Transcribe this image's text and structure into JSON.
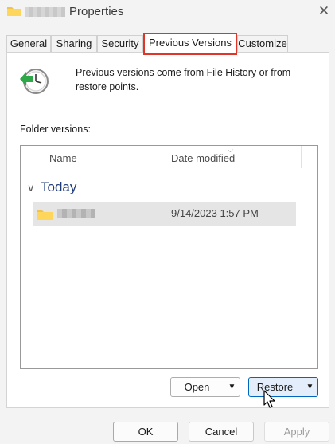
{
  "window": {
    "title": "Properties",
    "close_label": "✕"
  },
  "tabs": [
    {
      "label": "General"
    },
    {
      "label": "Sharing"
    },
    {
      "label": "Security"
    },
    {
      "label": "Previous Versions"
    },
    {
      "label": "Customize"
    }
  ],
  "active_tab": "Previous Versions",
  "intro_text": "Previous versions come from File History or from restore points.",
  "folder_versions_label": "Folder versions:",
  "list": {
    "columns": [
      "Name",
      "Date modified"
    ],
    "groups": [
      {
        "label": "Today",
        "items": [
          {
            "date_modified": "9/14/2023 1:57 PM"
          }
        ]
      }
    ]
  },
  "actions": {
    "open_label": "Open",
    "restore_label": "Restore"
  },
  "dialog_buttons": {
    "ok": "OK",
    "cancel": "Cancel",
    "apply": "Apply"
  },
  "colors": {
    "active_tab_outline": "#e0362a",
    "group_header": "#1e3a78",
    "hover_button": "#0067c0"
  },
  "icons": {
    "title": "folder-icon",
    "header": "previous-versions-clock-icon",
    "row": "folder-icon",
    "cursor": "mouse-pointer"
  }
}
